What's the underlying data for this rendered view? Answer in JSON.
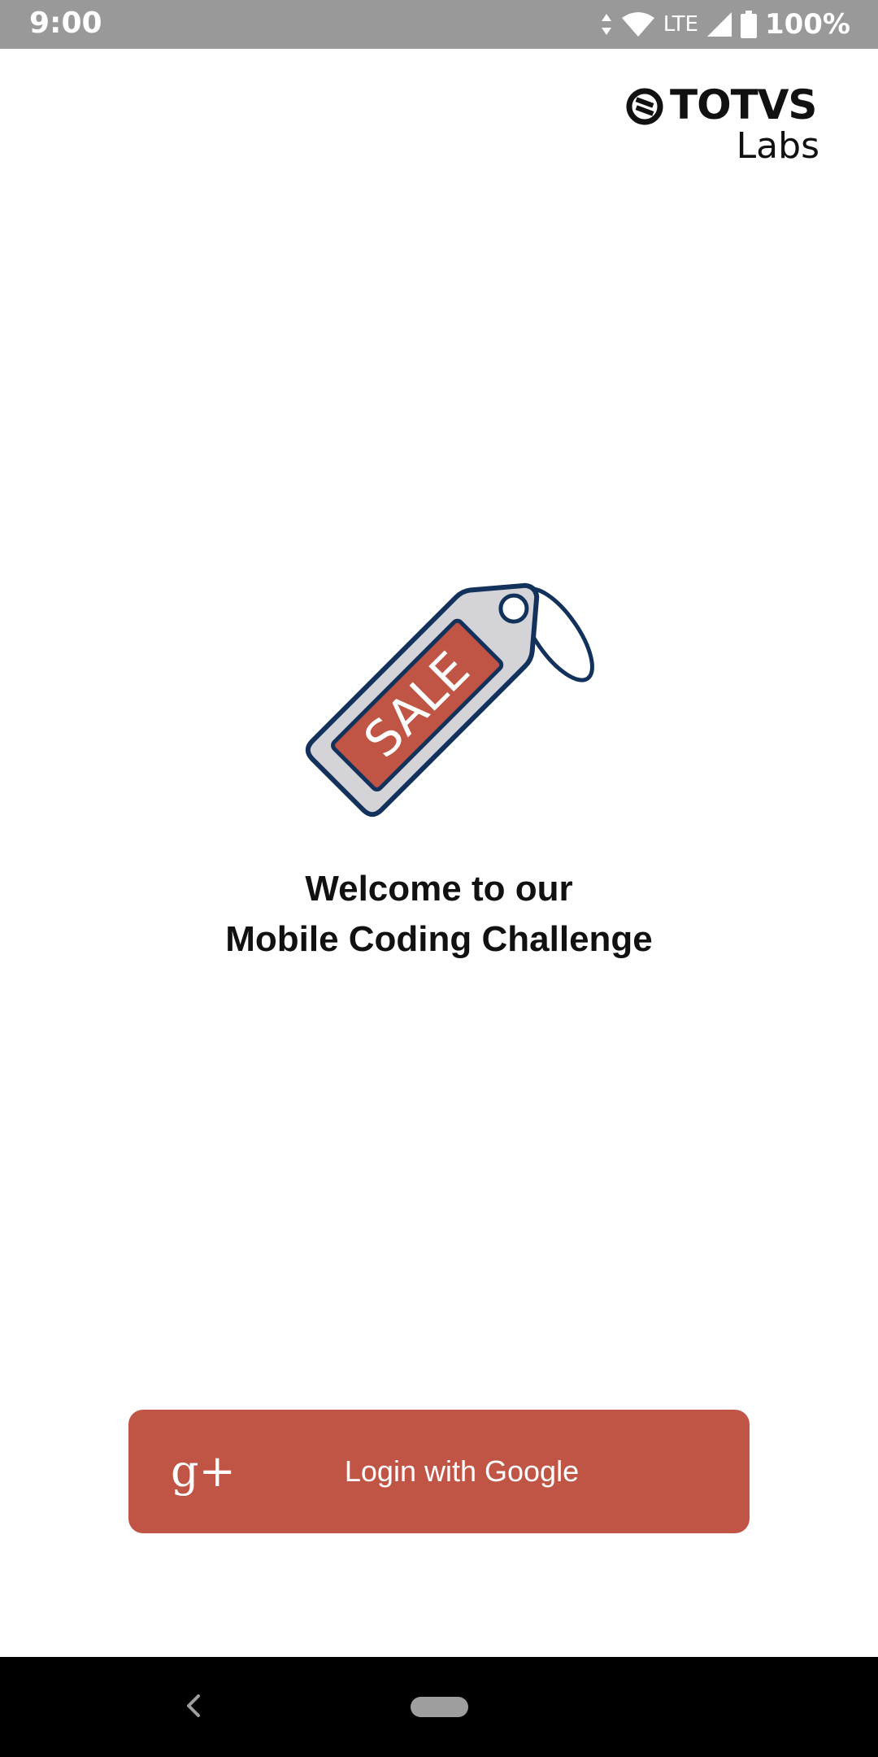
{
  "status_bar": {
    "time": "9:00",
    "network": "LTE",
    "battery": "100%",
    "icons": [
      "data-arrows-icon",
      "wifi-icon",
      "signal-icon",
      "battery-icon"
    ]
  },
  "logo": {
    "word": "TOTVS",
    "sub": "Labs"
  },
  "illustration": {
    "icon": "sale-tag-icon",
    "tag_text": "SALE",
    "colors": {
      "tag_body": "#d4d4d8",
      "tag_label": "#c05546",
      "outline": "#12325c"
    }
  },
  "welcome": {
    "line1": "Welcome to our",
    "line2": "Mobile Coding Challenge"
  },
  "login": {
    "icon_text": "g+",
    "label": "Login with Google",
    "color": "#c05546"
  },
  "nav": {
    "icons": [
      "back-icon",
      "home-pill-icon"
    ]
  }
}
